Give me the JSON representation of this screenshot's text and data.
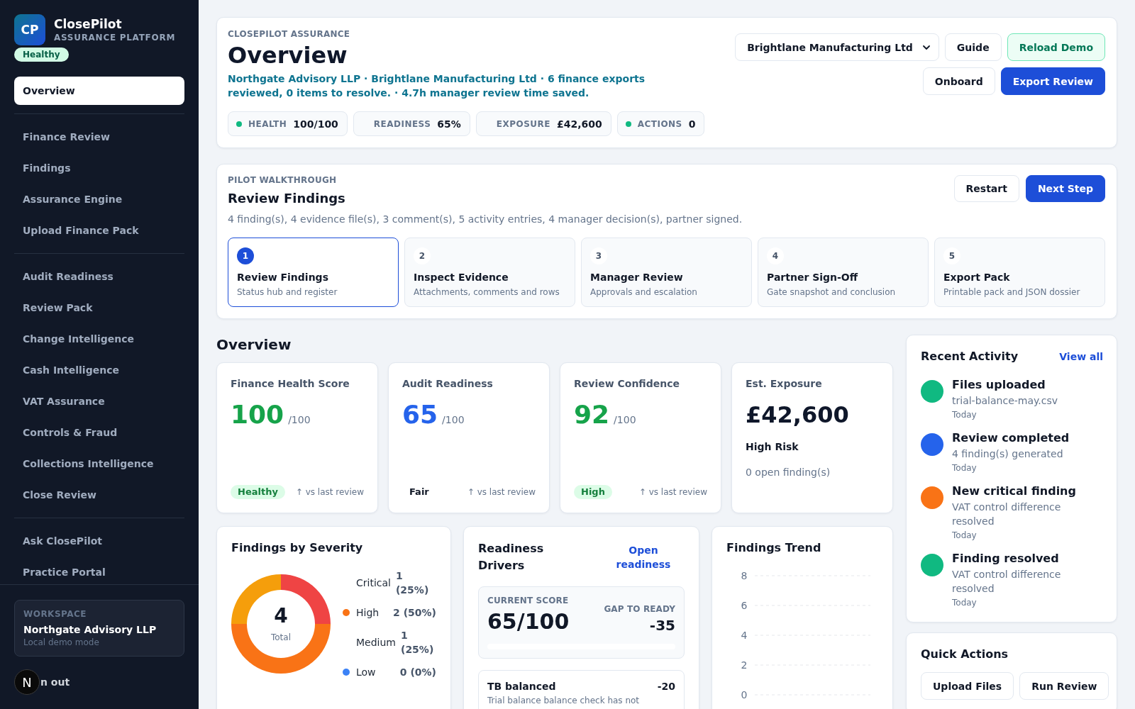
{
  "sidebar": {
    "logo": "CP",
    "app_name": "ClosePilot",
    "tagline": "ASSURANCE PLATFORM",
    "status_badge": "Healthy",
    "nav_groups": [
      {
        "items": [
          {
            "label": "Overview",
            "selected": true
          }
        ]
      },
      {
        "items": [
          {
            "label": "Finance Review",
            "selected": false
          },
          {
            "label": "Findings",
            "selected": false
          },
          {
            "label": "Assurance Engine",
            "selected": false
          },
          {
            "label": "Upload Finance Pack",
            "selected": false
          }
        ]
      },
      {
        "items": [
          {
            "label": "Audit Readiness",
            "selected": false
          },
          {
            "label": "Review Pack",
            "selected": false
          },
          {
            "label": "Change Intelligence",
            "selected": false
          },
          {
            "label": "Cash Intelligence",
            "selected": false
          },
          {
            "label": "VAT Assurance",
            "selected": false
          },
          {
            "label": "Controls & Fraud",
            "selected": false
          },
          {
            "label": "Collections Intelligence",
            "selected": false
          },
          {
            "label": "Close Review",
            "selected": false
          }
        ]
      },
      {
        "items": [
          {
            "label": "Ask ClosePilot",
            "selected": false
          },
          {
            "label": "Practice Portal",
            "selected": false
          }
        ]
      }
    ],
    "workspace": {
      "label": "WORKSPACE",
      "name": "Northgate Advisory LLP",
      "mode": "Local demo mode"
    },
    "sign_out_label": "n out",
    "dev_badge": "N"
  },
  "header": {
    "eyebrow": "CLOSEPILOT ASSURANCE",
    "title": "Overview",
    "subtitle": "Northgate Advisory LLP · Brightlane Manufacturing Ltd · 6 finance exports reviewed, 0 items to resolve. · 4.7h manager review time saved.",
    "chips": [
      {
        "label": "HEALTH",
        "value": "100/100",
        "color": "#10b981"
      },
      {
        "label": "READINESS",
        "value": "65%"
      },
      {
        "label": "EXPOSURE",
        "value": "£42,600"
      },
      {
        "label": "ACTIONS",
        "value": "0",
        "color": "#10b981"
      }
    ],
    "client_select": {
      "value": "Brightlane Manufacturing Ltd"
    },
    "buttons": [
      {
        "label": "Guide",
        "kind": "secondary"
      },
      {
        "label": "Reload Demo",
        "kind": "success"
      },
      {
        "label": "Onboard",
        "kind": "secondary"
      },
      {
        "label": "Export Review",
        "kind": "primary"
      }
    ]
  },
  "walkthrough": {
    "eyebrow": "PILOT WALKTHROUGH",
    "title": "Review Findings",
    "summary": "4 finding(s), 4 evidence file(s), 3 comment(s), 5 activity entries, 4 manager decision(s), partner signed.",
    "buttons": [
      {
        "label": "Restart",
        "kind": "secondary"
      },
      {
        "label": "Next Step",
        "kind": "primary"
      }
    ],
    "steps": [
      {
        "number": "1",
        "title": "Review Findings",
        "caption": "Status hub and register",
        "selected": true
      },
      {
        "number": "2",
        "title": "Inspect Evidence",
        "caption": "Attachments, comments and rows",
        "selected": false
      },
      {
        "number": "3",
        "title": "Manager Review",
        "caption": "Approvals and escalation",
        "selected": false
      },
      {
        "number": "4",
        "title": "Partner Sign-Off",
        "caption": "Gate snapshot and conclusion",
        "selected": false
      },
      {
        "number": "5",
        "title": "Export Pack",
        "caption": "Printable pack and JSON dossier",
        "selected": false
      }
    ]
  },
  "overview": {
    "heading": "Overview",
    "metrics": [
      {
        "kind": "score",
        "title": "Finance Health Score",
        "value": "100",
        "suffix": "/100",
        "color": "#16a34a",
        "badge": {
          "label": "Healthy",
          "kind": "pill"
        },
        "trend": "↑ vs last review"
      },
      {
        "kind": "score",
        "title": "Audit Readiness",
        "value": "65",
        "suffix": "/100",
        "color": "#2563eb",
        "badge": {
          "label": "Fair",
          "kind": "text"
        },
        "trend": "↑ vs last review"
      },
      {
        "kind": "score",
        "title": "Review Confidence",
        "value": "92",
        "suffix": "/100",
        "color": "#16a34a",
        "badge": {
          "label": "High",
          "kind": "pill"
        },
        "trend": "↑ vs last review"
      },
      {
        "kind": "exposure",
        "title": "Est. Exposure",
        "value": "£42,600",
        "risk": "High Risk",
        "note": "0 open finding(s)"
      }
    ]
  },
  "severity": {
    "chart_data": {
      "type": "donut",
      "title": "Findings by Severity",
      "categories": [
        "Critical",
        "High",
        "Medium",
        "Low"
      ],
      "values": [
        25,
        50,
        25,
        0
      ],
      "colors": [
        "#ef4444",
        "#f97316",
        "#f59e0b",
        "#3b82f6"
      ]
    },
    "total": "4",
    "total_label": "Total",
    "legend": [
      {
        "value": "1 (25%)",
        "dot": false
      },
      {
        "value": "2 (50%)",
        "dot": true
      },
      {
        "value": "1 (25%)",
        "dot": false
      },
      {
        "value": "0 (0%)",
        "dot": true
      }
    ]
  },
  "readiness": {
    "title": "Readiness Drivers",
    "link": "Open readiness",
    "score_label": "CURRENT SCORE",
    "score": "65/100",
    "gap_label": "GAP TO READY",
    "gap": "-35",
    "drivers": [
      {
        "name": "TB balanced",
        "impact": "-20",
        "description": "Trial balance balance check has not"
      }
    ]
  },
  "trend": {
    "title": "Findings Trend",
    "axis_labels": [
      "8",
      "6",
      "4",
      "2",
      "0"
    ]
  },
  "activity": {
    "title": "Recent Activity",
    "link": "View all",
    "items": [
      {
        "title": "Files uploaded",
        "detail": "trial-balance-may.csv",
        "time": "Today",
        "color": "#10b981"
      },
      {
        "title": "Review completed",
        "detail": "4 finding(s) generated",
        "time": "Today",
        "color": "#2563eb"
      },
      {
        "title": "New critical finding",
        "detail": "VAT control difference resolved",
        "time": "Today",
        "color": "#f97316"
      },
      {
        "title": "Finding resolved",
        "detail": "VAT control difference resolved",
        "time": "Today",
        "color": "#10b981"
      }
    ]
  },
  "quick_actions": {
    "title": "Quick Actions",
    "buttons": [
      "Upload Files",
      "Run Review"
    ]
  }
}
